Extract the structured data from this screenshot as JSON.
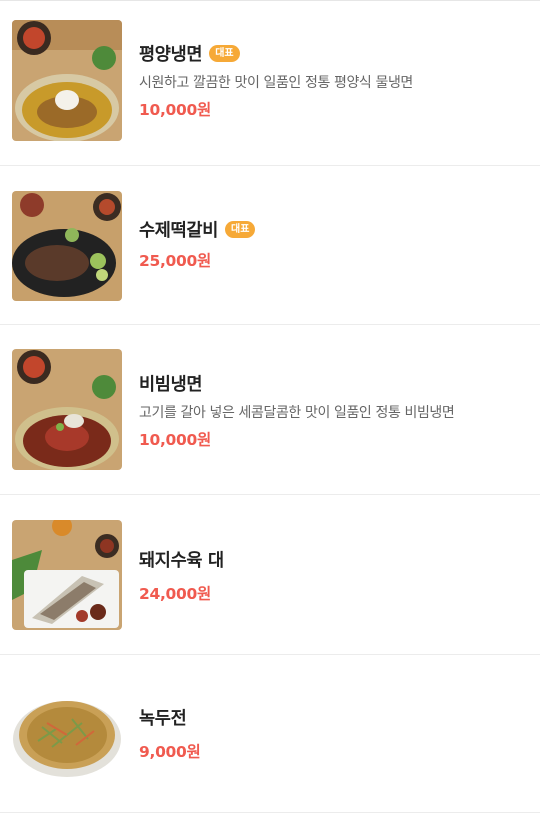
{
  "menu": {
    "items": [
      {
        "name": "평양냉면",
        "badge": "대표",
        "description": "시원하고 깔끔한 맛이 일품인 정통 평양식 물냉면",
        "price": "10,000원"
      },
      {
        "name": "수제떡갈비",
        "badge": "대표",
        "description": "",
        "price": "25,000원"
      },
      {
        "name": "비빔냉면",
        "badge": "",
        "description": "고기를 갈아 넣은 세콤달콤한 맛이 일품인 정통 비빔냉면",
        "price": "10,000원"
      },
      {
        "name": "돼지수육 대",
        "badge": "",
        "description": "",
        "price": "24,000원"
      },
      {
        "name": "녹두전",
        "badge": "",
        "description": "",
        "price": "9,000원"
      }
    ]
  },
  "colors": {
    "badge": "#f6a937",
    "price": "#f05a4f"
  }
}
